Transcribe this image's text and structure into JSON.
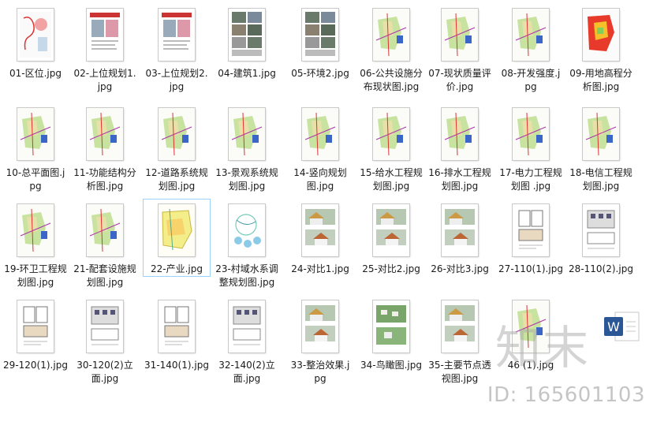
{
  "files": [
    {
      "name": "01-区位.jpg",
      "kind": "map"
    },
    {
      "name": "02-上位规划1.jpg",
      "kind": "doc"
    },
    {
      "name": "03-上位规划2.jpg",
      "kind": "doc"
    },
    {
      "name": "04-建筑1.jpg",
      "kind": "photos"
    },
    {
      "name": "05-环境2.jpg",
      "kind": "photos"
    },
    {
      "name": "06-公共设施分布现状图.jpg",
      "kind": "plan"
    },
    {
      "name": "07-现状质量评价.jpg",
      "kind": "plan"
    },
    {
      "name": "08-开发强度.jpg",
      "kind": "plan"
    },
    {
      "name": "09-用地高程分析图.jpg",
      "kind": "heat"
    },
    {
      "name": "10-总平面图.jpg",
      "kind": "plan"
    },
    {
      "name": "11-功能结构分析图.jpg",
      "kind": "plan"
    },
    {
      "name": "12-道路系统规划图.jpg",
      "kind": "plan"
    },
    {
      "name": "13-景观系统规划图.jpg",
      "kind": "plan"
    },
    {
      "name": "14-竖向规划图.jpg",
      "kind": "plan"
    },
    {
      "name": "15-给水工程规划图.jpg",
      "kind": "plan"
    },
    {
      "name": "16-排水工程规划图.jpg",
      "kind": "plan"
    },
    {
      "name": "17-电力工程规划图 .jpg",
      "kind": "plan"
    },
    {
      "name": "18-电信工程规划图.jpg",
      "kind": "plan"
    },
    {
      "name": "19-环卫工程规划图.jpg",
      "kind": "plan"
    },
    {
      "name": "21-配套设施规划图.jpg",
      "kind": "plan"
    },
    {
      "name": "22-产业.jpg",
      "kind": "yellowmap"
    },
    {
      "name": "23-村域水系调整规划图.jpg",
      "kind": "water"
    },
    {
      "name": "24-对比1.jpg",
      "kind": "houses"
    },
    {
      "name": "25-对比2.jpg",
      "kind": "houses"
    },
    {
      "name": "26-对比3.jpg",
      "kind": "houses"
    },
    {
      "name": "27-110(1).jpg",
      "kind": "floorplan"
    },
    {
      "name": "28-110(2).jpg",
      "kind": "elevation"
    },
    {
      "name": "29-120(1).jpg",
      "kind": "floorplan"
    },
    {
      "name": "30-120(2)立面.jpg",
      "kind": "elevation"
    },
    {
      "name": "31-140(1).jpg",
      "kind": "floorplan"
    },
    {
      "name": "32-140(2)立面.jpg",
      "kind": "elevation"
    },
    {
      "name": "33-整治效果.jpg",
      "kind": "houses"
    },
    {
      "name": "34-鸟瞰图.jpg",
      "kind": "aerial"
    },
    {
      "name": "35-主要节点透视图.jpg",
      "kind": "houses"
    },
    {
      "name": "46 (1).jpg",
      "kind": "plan"
    }
  ],
  "selected_index": 20,
  "watermark": {
    "brand": "知末",
    "id_text": "ID: 165601103"
  },
  "colors": {
    "selection": "#99d1ff",
    "text": "#1a1a1a"
  }
}
